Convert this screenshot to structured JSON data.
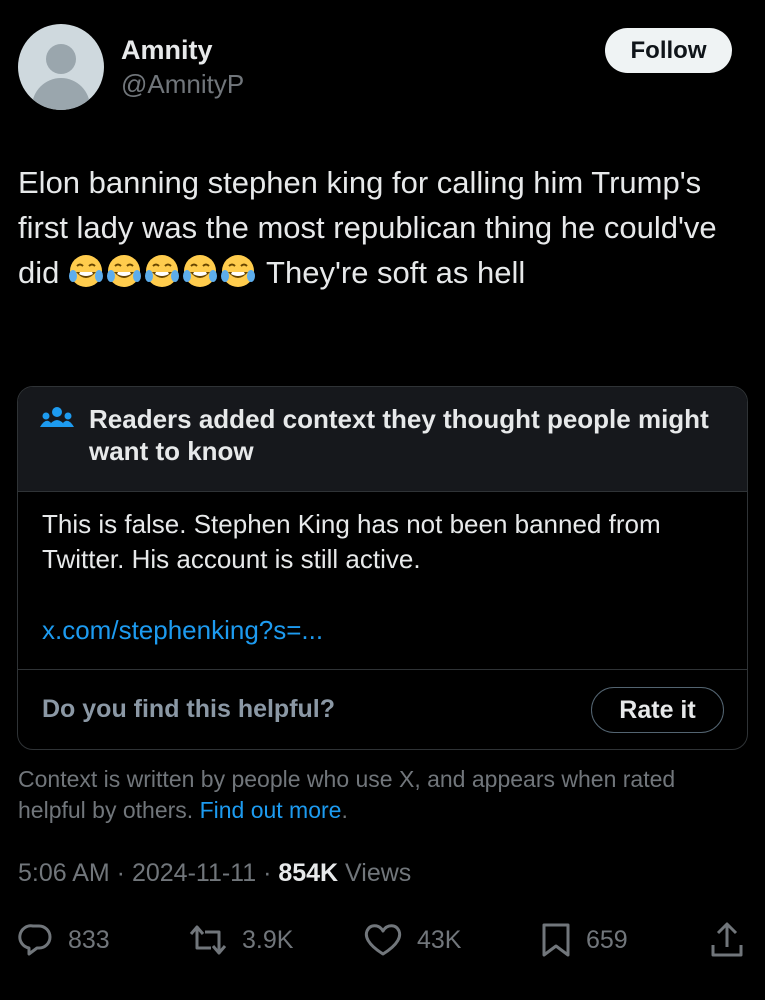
{
  "author": {
    "display_name": "Amnity",
    "handle": "@AmnityP"
  },
  "follow_button": {
    "label": "Follow"
  },
  "tweet": {
    "text_before_emoji": "Elon banning stephen king for calling him Trump's first lady was the most republican thing he could've did ",
    "emojis": [
      "face-with-tears-of-joy",
      "face-with-tears-of-joy",
      "face-with-tears-of-joy",
      "face-with-tears-of-joy",
      "face-with-tears-of-joy"
    ],
    "text_after_emoji": " They're soft as hell"
  },
  "community_note": {
    "icon": "readers-group-icon",
    "title": "Readers added context they thought people might want to know",
    "body": "This is false. Stephen King has not been banned from Twitter. His account is still active.",
    "link": "x.com/stephenking?s=...",
    "helpful_prompt": "Do you find this helpful?",
    "rate_button": "Rate it"
  },
  "context_footer": {
    "text": "Context is written by people who use X, and appears when rated helpful by others.",
    "link": "Find out more",
    "trailing": "."
  },
  "meta": {
    "time": "5:06 AM",
    "separator": " · ",
    "date": "2024-11-11",
    "views_count": "854K",
    "views_label": " Views"
  },
  "actions": {
    "replies": "833",
    "reposts": "3.9K",
    "likes": "43K",
    "bookmarks": "659"
  },
  "colors": {
    "background": "#000000",
    "text": "#e7e9ea",
    "muted": "#71767b",
    "link": "#1d9bf0",
    "border": "#2f3336",
    "note_header_bg": "#16181c"
  }
}
